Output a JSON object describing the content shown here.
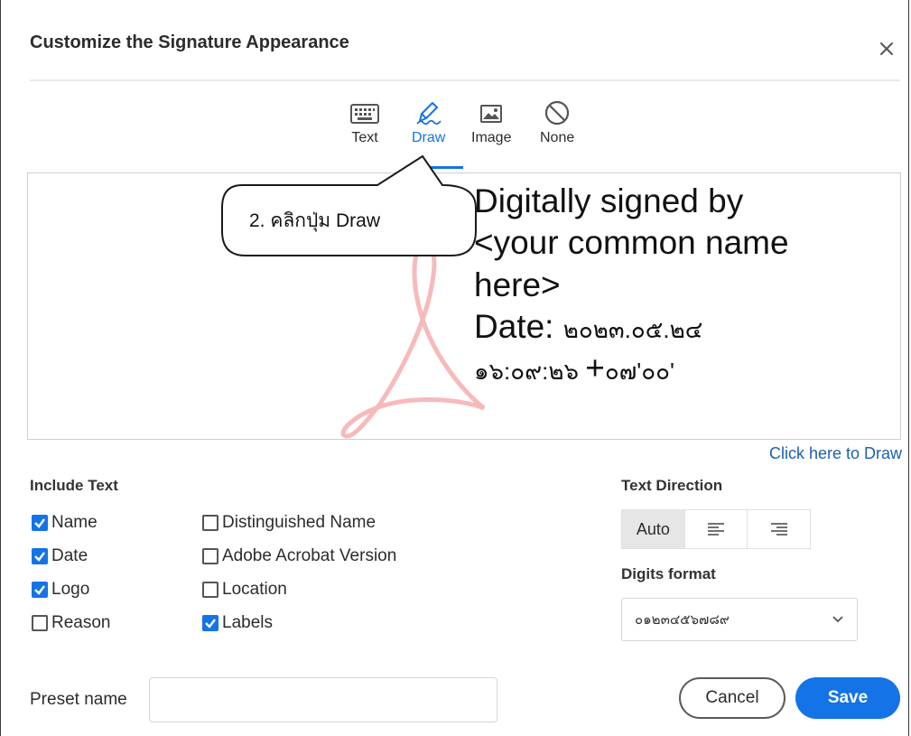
{
  "dialog": {
    "title": "Customize the Signature Appearance"
  },
  "tabs": [
    {
      "label": "Text",
      "icon": "keyboard-icon",
      "active": false
    },
    {
      "label": "Draw",
      "icon": "pen-draw-icon",
      "active": true
    },
    {
      "label": "Image",
      "icon": "image-icon",
      "active": false
    },
    {
      "label": "None",
      "icon": "no-symbol-icon",
      "active": false
    }
  ],
  "callout": {
    "text": "2. คลิกปุ่ม Draw"
  },
  "preview": {
    "line1": "Digitally signed by",
    "line2": "<your common name",
    "line3": "here>",
    "date_label": "Date: ",
    "date_value": "๒๐๒๓.๐๕.๒๔",
    "time_value": "๑๖:๐๙:๒๖ ",
    "tz_plus": "+",
    "tz_value": "๐๗'๐๐'"
  },
  "draw_link": "Click here to Draw",
  "include_text": {
    "label": "Include Text",
    "items": [
      {
        "label": "Name",
        "checked": true
      },
      {
        "label": "Date",
        "checked": true
      },
      {
        "label": "Logo",
        "checked": true
      },
      {
        "label": "Reason",
        "checked": false
      },
      {
        "label": "Distinguished Name",
        "checked": false
      },
      {
        "label": "Adobe Acrobat Version",
        "checked": false
      },
      {
        "label": "Location",
        "checked": false
      },
      {
        "label": "Labels",
        "checked": true
      }
    ]
  },
  "text_direction": {
    "label": "Text Direction",
    "auto_label": "Auto",
    "selected": "Auto"
  },
  "digits_format": {
    "label": "Digits format",
    "value": "๐๑๒๓๔๕๖๗๘๙"
  },
  "preset": {
    "label": "Preset name",
    "value": ""
  },
  "buttons": {
    "cancel": "Cancel",
    "save": "Save"
  },
  "colors": {
    "accent": "#1473e6",
    "link": "#1d5fb6",
    "logo_red": "#e8393a"
  }
}
